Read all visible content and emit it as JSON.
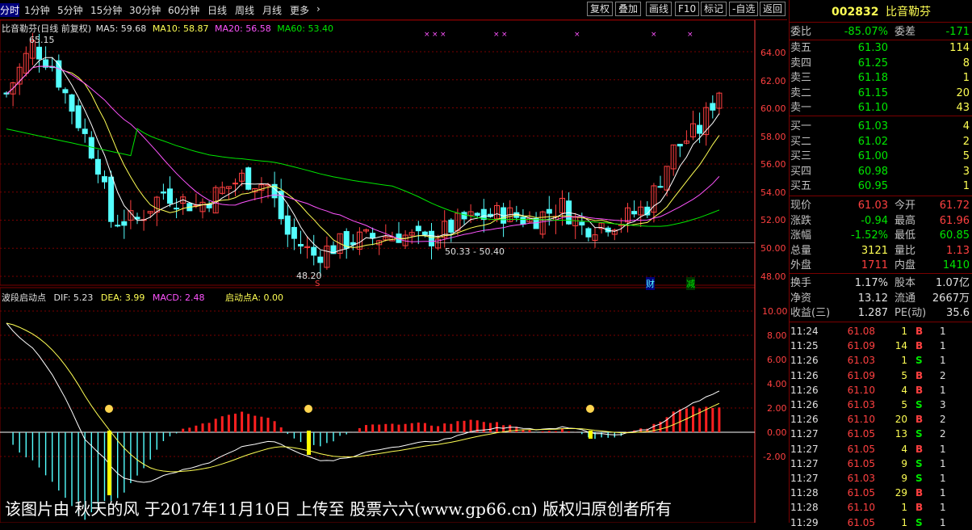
{
  "toolbar": {
    "left_items": [
      "分时",
      "1分钟",
      "5分钟",
      "15分钟",
      "30分钟",
      "60分钟",
      "日线",
      "周线",
      "月线",
      "更多",
      "›"
    ],
    "right_items": [
      "复权",
      "叠加",
      "画线",
      "F10",
      "标记",
      "-自选",
      "返回"
    ]
  },
  "main_chart": {
    "legend_title": "比音勒芬(日线 前复权)",
    "ma5": "MA5: 59.68",
    "ma10": "MA10: 58.87",
    "ma20": "MA20: 56.58",
    "ma60": "MA60: 53.40",
    "high_label": "65.15",
    "low_label": "48.20",
    "range_label": "50.33 - 50.40",
    "y_axis": [
      "64.00",
      "62.00",
      "60.00",
      "58.00",
      "56.00",
      "54.00",
      "52.00",
      "50.00",
      "48.00"
    ],
    "markers": {
      "cai": "财",
      "jian": "减",
      "s": "S"
    }
  },
  "sub_chart": {
    "legend_title": "波段启动点",
    "dif": "DIF: 5.23",
    "dea": "DEA: 3.99",
    "macd": "MACD: 2.48",
    "qidong": "启动点A: 0.00",
    "y_axis": [
      "10.00",
      "8.00",
      "6.00",
      "4.00",
      "2.00",
      "0.00",
      "-2.00"
    ]
  },
  "quote": {
    "code": "002832",
    "name": "比音勒芬",
    "weibi_label": "委比",
    "weibi": "-85.07%",
    "weicha_label": "委差",
    "weicha": "-171",
    "asks": [
      {
        "label": "卖五",
        "price": "61.30",
        "vol": "114"
      },
      {
        "label": "卖四",
        "price": "61.25",
        "vol": "8"
      },
      {
        "label": "卖三",
        "price": "61.18",
        "vol": "1"
      },
      {
        "label": "卖二",
        "price": "61.15",
        "vol": "20"
      },
      {
        "label": "卖一",
        "price": "61.10",
        "vol": "43"
      }
    ],
    "bids": [
      {
        "label": "买一",
        "price": "61.03",
        "vol": "4"
      },
      {
        "label": "买二",
        "price": "61.02",
        "vol": "2"
      },
      {
        "label": "买三",
        "price": "61.00",
        "vol": "5"
      },
      {
        "label": "买四",
        "price": "60.98",
        "vol": "3"
      },
      {
        "label": "买五",
        "price": "60.95",
        "vol": "1"
      }
    ],
    "stats": [
      {
        "l1": "现价",
        "v1": "61.03",
        "c1": "red",
        "l2": "今开",
        "v2": "61.72",
        "c2": "red"
      },
      {
        "l1": "涨跌",
        "v1": "-0.94",
        "c1": "green",
        "l2": "最高",
        "v2": "61.96",
        "c2": "red"
      },
      {
        "l1": "涨幅",
        "v1": "-1.52%",
        "c1": "green",
        "l2": "最低",
        "v2": "60.85",
        "c2": "green"
      },
      {
        "l1": "总量",
        "v1": "3121",
        "c1": "yellow",
        "l2": "量比",
        "v2": "1.13",
        "c2": "red"
      },
      {
        "l1": "外盘",
        "v1": "1711",
        "c1": "red",
        "l2": "内盘",
        "v2": "1410",
        "c2": "green"
      }
    ],
    "stats2": [
      {
        "l1": "换手",
        "v1": "1.17%",
        "l2": "股本",
        "v2": "1.07亿"
      },
      {
        "l1": "净资",
        "v1": "13.12",
        "l2": "流通",
        "v2": "2667万"
      },
      {
        "l1": "收益(三)",
        "v1": "1.287",
        "l2": "PE(动)",
        "v2": "35.6"
      }
    ],
    "ticks": [
      {
        "t": "11:24",
        "p": "61.08",
        "q": "1",
        "bs": "B",
        "n": "1"
      },
      {
        "t": "11:25",
        "p": "61.09",
        "q": "14",
        "bs": "B",
        "n": "1"
      },
      {
        "t": "11:26",
        "p": "61.03",
        "q": "1",
        "bs": "S",
        "n": "1"
      },
      {
        "t": "11:26",
        "p": "61.09",
        "q": "5",
        "bs": "B",
        "n": "2"
      },
      {
        "t": "11:26",
        "p": "61.10",
        "q": "4",
        "bs": "B",
        "n": "1"
      },
      {
        "t": "11:26",
        "p": "61.03",
        "q": "5",
        "bs": "S",
        "n": "3"
      },
      {
        "t": "11:26",
        "p": "61.10",
        "q": "20",
        "bs": "B",
        "n": "2"
      },
      {
        "t": "11:27",
        "p": "61.05",
        "q": "13",
        "bs": "S",
        "n": "2"
      },
      {
        "t": "11:27",
        "p": "61.05",
        "q": "4",
        "bs": "B",
        "n": "1"
      },
      {
        "t": "11:27",
        "p": "61.05",
        "q": "9",
        "bs": "S",
        "n": "1"
      },
      {
        "t": "11:27",
        "p": "61.03",
        "q": "9",
        "bs": "S",
        "n": "1"
      },
      {
        "t": "11:28",
        "p": "61.05",
        "q": "29",
        "bs": "B",
        "n": "1"
      },
      {
        "t": "11:28",
        "p": "61.10",
        "q": "1",
        "bs": "B",
        "n": "1"
      },
      {
        "t": "11:29",
        "p": "61.05",
        "q": "1",
        "bs": "S",
        "n": "1"
      }
    ]
  },
  "watermark": "该图片由 秋天的风 于2017年11月10日 上传至 股票六六(www.gp66.cn) 版权归原创者所有",
  "colors": {
    "up": "#ff4040",
    "down": "#54ffff",
    "ma5": "#ffffff",
    "ma10": "#ffff54",
    "ma20": "#ff54ff",
    "ma60": "#00e600",
    "grid": "#7a0000"
  }
}
